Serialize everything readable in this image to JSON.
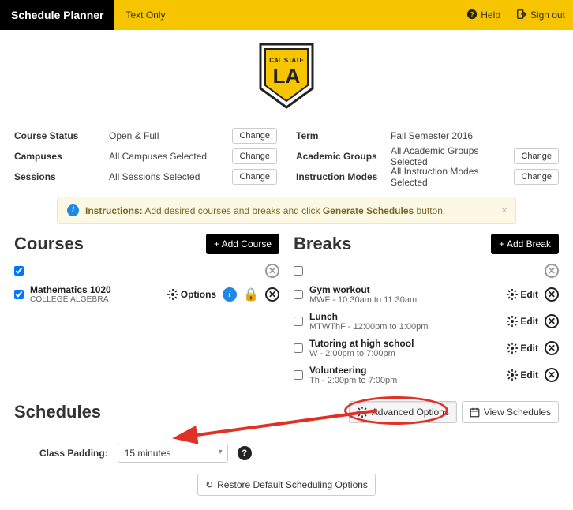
{
  "topbar": {
    "brand": "Schedule Planner",
    "textOnly": "Text Only",
    "help": "Help",
    "signOut": "Sign out"
  },
  "logo": {
    "line1": "CAL STATE",
    "line2": "LA"
  },
  "filtersLeft": [
    {
      "label": "Course Status",
      "value": "Open & Full",
      "change": "Change"
    },
    {
      "label": "Campuses",
      "value": "All Campuses Selected",
      "change": "Change"
    },
    {
      "label": "Sessions",
      "value": "All Sessions Selected",
      "change": "Change"
    }
  ],
  "filtersRight": [
    {
      "label": "Term",
      "value": "Fall Semester 2016",
      "change": ""
    },
    {
      "label": "Academic Groups",
      "value": "All Academic Groups Selected",
      "change": "Change"
    },
    {
      "label": "Instruction Modes",
      "value": "All Instruction Modes Selected",
      "change": "Change"
    }
  ],
  "alert": {
    "prefix": "Instructions:",
    "text": " Add desired courses and breaks and click ",
    "bold": "Generate Schedules",
    "suffix": " button!"
  },
  "courses": {
    "title": "Courses",
    "addLabel": "+ Add Course",
    "optionsLabel": "Options",
    "items": [
      {
        "title": "Mathematics 1020",
        "sub": "COLLEGE ALGEBRA"
      }
    ]
  },
  "breaks": {
    "title": "Breaks",
    "addLabel": "+ Add Break",
    "editLabel": "Edit",
    "items": [
      {
        "title": "Gym workout",
        "sub": "MWF - 10:30am to 11:30am"
      },
      {
        "title": "Lunch",
        "sub": "MTWThF - 12:00pm to 1:00pm"
      },
      {
        "title": "Tutoring at high school",
        "sub": "W - 2:00pm to 7:00pm"
      },
      {
        "title": "Volunteering",
        "sub": "Th - 2:00pm to 7:00pm"
      }
    ]
  },
  "schedules": {
    "title": "Schedules",
    "advanced": "Advanced Options",
    "view": "View Schedules",
    "paddingLabel": "Class Padding:",
    "paddingValue": "15 minutes",
    "restore": "Restore Default Scheduling Options"
  }
}
